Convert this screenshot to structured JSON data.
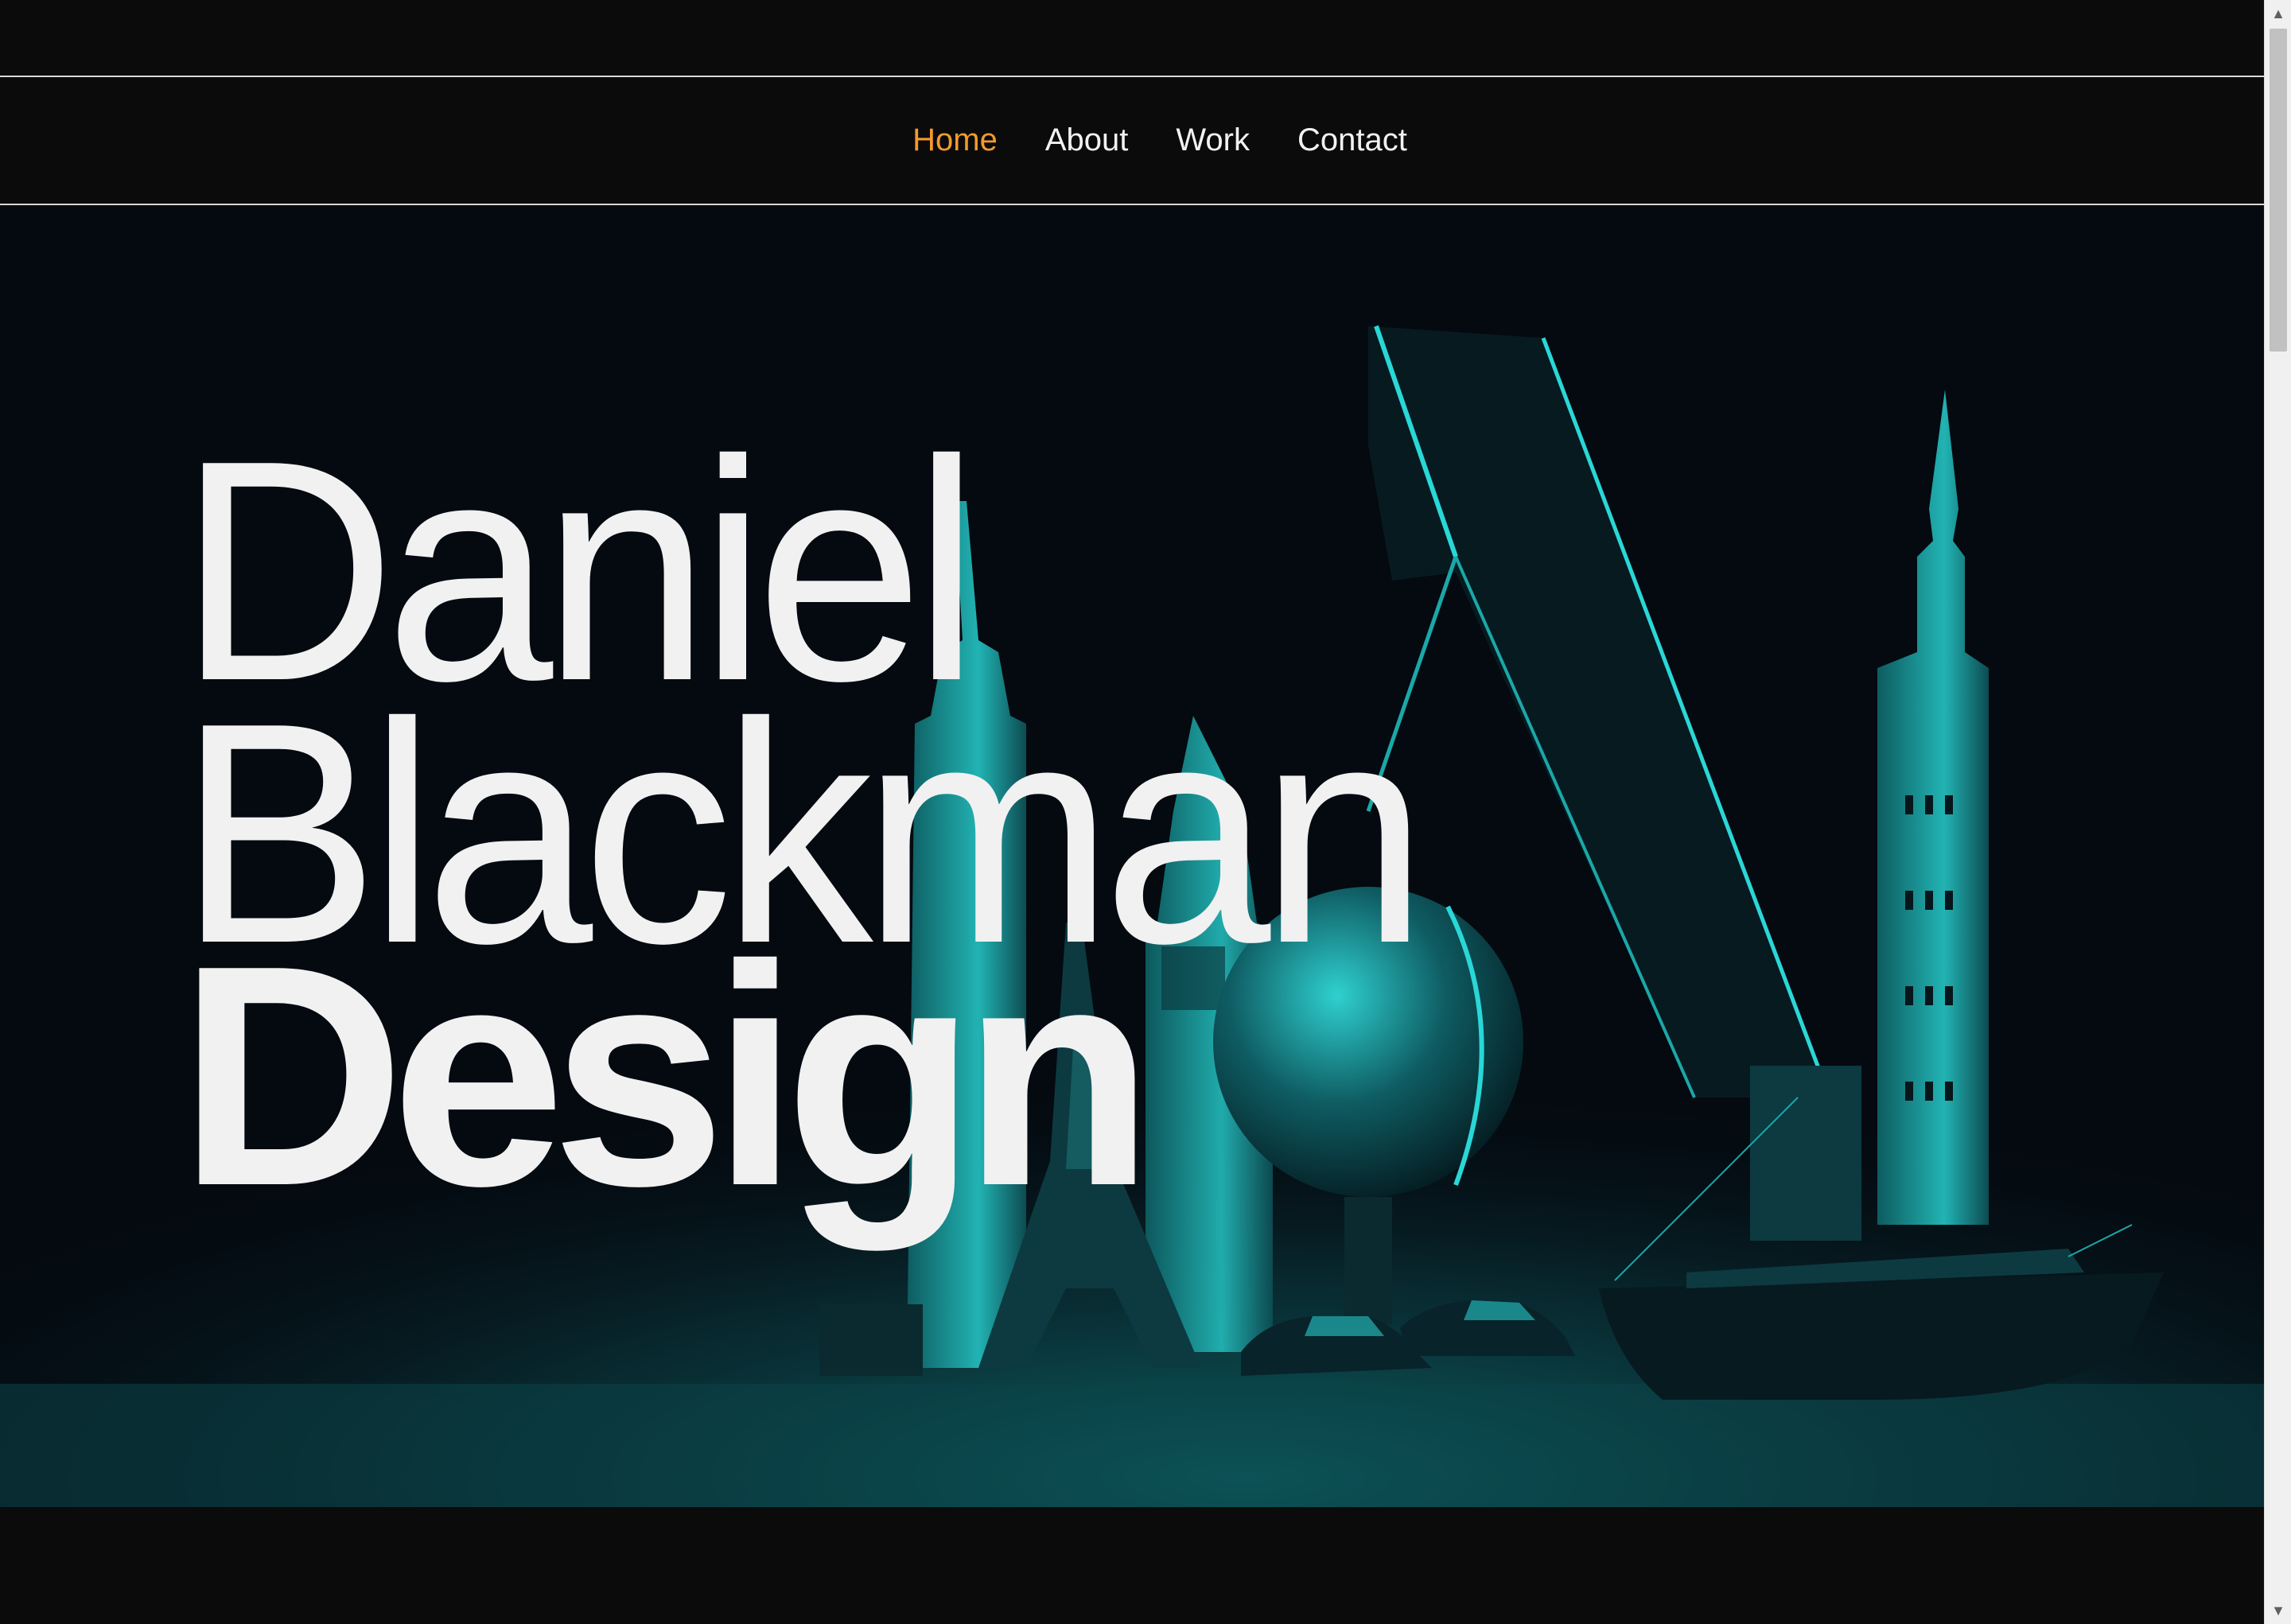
{
  "nav": {
    "items": [
      {
        "label": "Home",
        "active": true
      },
      {
        "label": "About",
        "active": false
      },
      {
        "label": "Work",
        "active": false
      },
      {
        "label": "Contact",
        "active": false
      }
    ],
    "active_color": "#f29a2e",
    "text_color": "#f2f2f2"
  },
  "hero": {
    "line1": "Daniel",
    "line2": "Blackman",
    "line3": "Design",
    "accent_color": "#1fb3b3",
    "background_color": "#040a10"
  },
  "scrollbar": {
    "up_icon": "chevron-up-icon",
    "down_icon": "chevron-down-icon"
  }
}
